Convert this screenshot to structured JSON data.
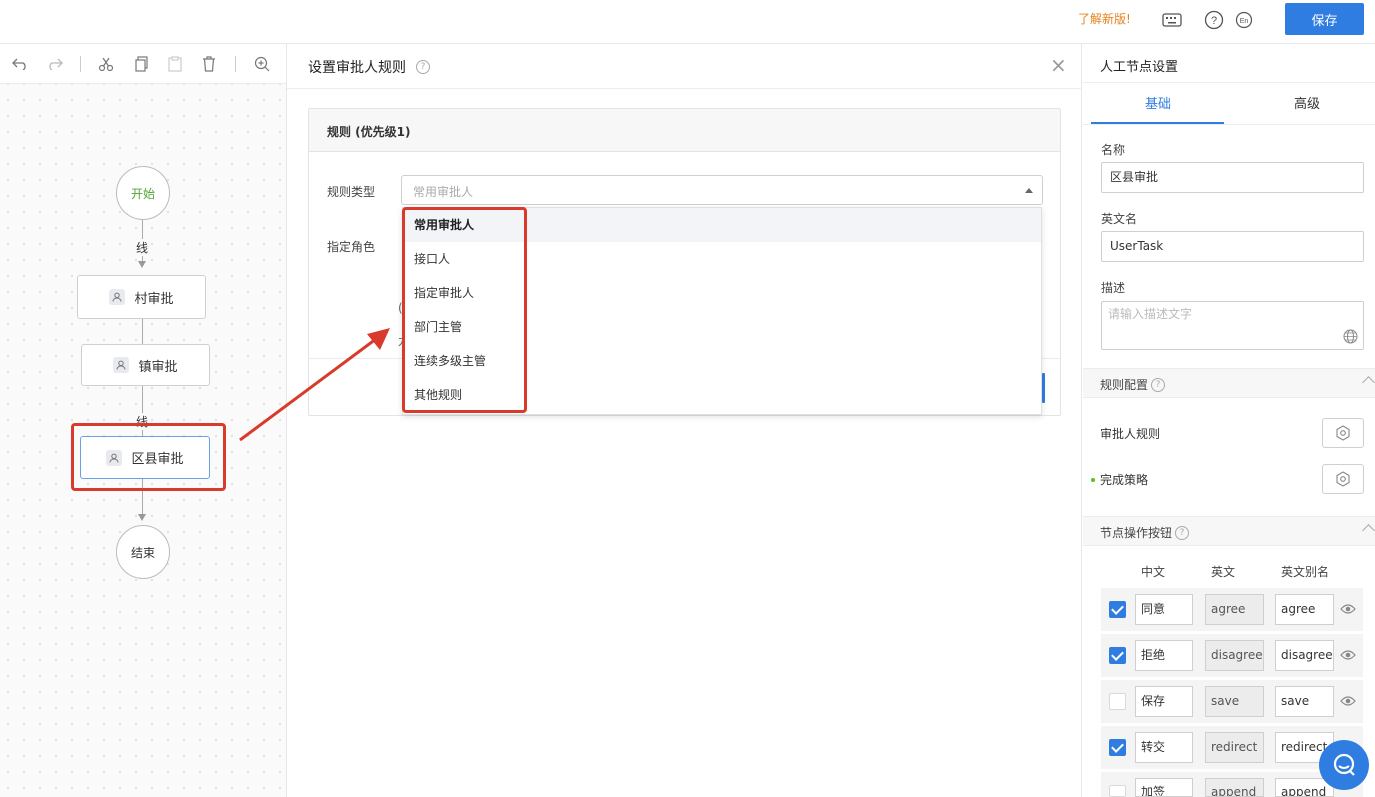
{
  "topbar": {
    "whats_new": "了解新版!",
    "keyboard_icon": "keyboard-icon",
    "help_icon": "help-circle-icon",
    "lang_icon": "language-en-icon",
    "save_label": "保存"
  },
  "canvas": {
    "toolbar_icons": [
      "undo-icon",
      "redo-icon",
      "cut-icon",
      "copy-icon",
      "paste-icon",
      "delete-icon",
      "zoom-in-icon"
    ],
    "nodes": {
      "start": "开始",
      "village": "村审批",
      "town": "镇审批",
      "county": "区县审批",
      "end": "结束"
    },
    "line_label_1": "线",
    "line_label_2": "线"
  },
  "dialog": {
    "title": "设置审批人规则",
    "rule_header": "规则 (优先级1)",
    "rule_type_label": "规则类型",
    "rule_type_placeholder": "常用审批人",
    "role_label": "指定角色",
    "peek_1": "(",
    "peek_2": "九",
    "options": [
      "常用审批人",
      "接口人",
      "指定审批人",
      "部门主管",
      "连续多级主管",
      "其他规则"
    ],
    "selected_option": "常用审批人"
  },
  "panel": {
    "title": "人工节点设置",
    "tab_basic": "基础",
    "tab_advanced": "高级",
    "name_label": "名称",
    "name_value": "区县审批",
    "en_name_label": "英文名",
    "en_name_value": "UserTask",
    "desc_label": "描述",
    "desc_placeholder": "请输入描述文字",
    "rule_config_title": "规则配置",
    "approver_rule_label": "审批人规则",
    "complete_strategy_label": "完成策略",
    "node_buttons_title": "节点操作按钮",
    "col_cn": "中文",
    "col_en": "英文",
    "col_alias": "英文别名",
    "buttons": [
      {
        "checked": true,
        "cn": "同意",
        "en": "agree",
        "alias": "agree"
      },
      {
        "checked": true,
        "cn": "拒绝",
        "en": "disagree",
        "alias": "disagree"
      },
      {
        "checked": false,
        "cn": "保存",
        "en": "save",
        "alias": "save"
      },
      {
        "checked": true,
        "cn": "转交",
        "en": "redirect",
        "alias": "redirect"
      },
      {
        "checked": false,
        "cn": "加签",
        "en": "append",
        "alias": "append"
      }
    ]
  },
  "colors": {
    "accent": "#2f7de1",
    "highlight": "#d83b2c",
    "whats_new": "#e6821e",
    "start_text": "#52a33a"
  }
}
